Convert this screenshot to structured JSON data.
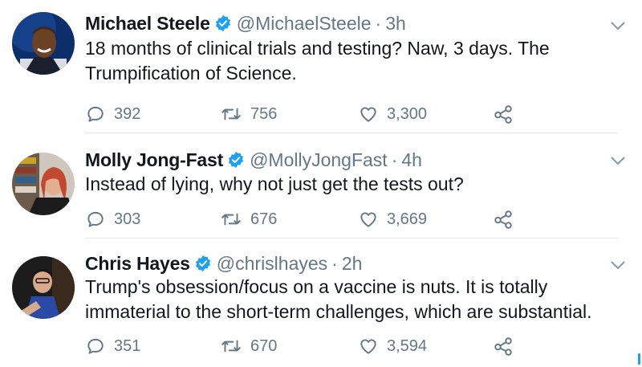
{
  "colors": {
    "accent": "#1da1f2",
    "secondary_text": "#657786",
    "divider": "#e1e8ed"
  },
  "tweets": [
    {
      "name": "Michael Steele",
      "handle": "@MichaelSteele",
      "separator": "·",
      "time": "3h",
      "verified": true,
      "text": "18 months of clinical trials and testing? Naw, 3 days. The Trumpification of Science.",
      "replies": "392",
      "retweets": "756",
      "likes": "3,300"
    },
    {
      "name": "Molly Jong-Fast",
      "handle": "@MollyJongFast",
      "separator": "·",
      "time": "4h",
      "verified": true,
      "text": "Instead of lying, why not just get the tests out?",
      "replies": "303",
      "retweets": "676",
      "likes": "3,669"
    },
    {
      "name": "Chris Hayes",
      "handle": "@chrislhayes",
      "separator": "·",
      "time": "2h",
      "verified": true,
      "text": "Trump's obsession/focus on a vaccine is nuts. It is totally immaterial to the short-term challenges, which are substantial.",
      "replies": "351",
      "retweets": "670",
      "likes": "3,594"
    }
  ],
  "icons": {
    "verified": "verified-badge-icon",
    "caret": "chevron-down-icon",
    "reply": "reply-icon",
    "retweet": "retweet-icon",
    "like": "heart-icon",
    "share": "share-icon"
  }
}
